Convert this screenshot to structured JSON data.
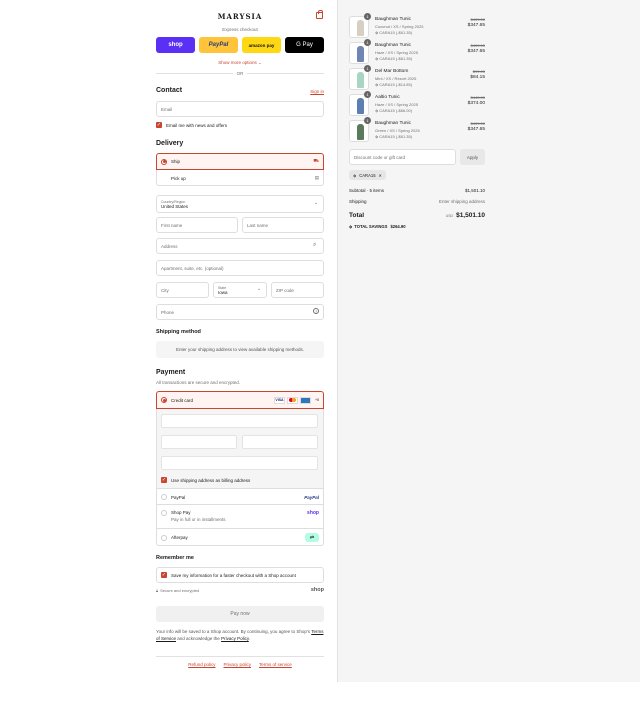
{
  "brand": {
    "logo": "MARYSIA"
  },
  "express": {
    "title": "Express checkout",
    "buttons": {
      "shop": "shop",
      "paypal": "PayPal",
      "amazon": "amazon pay",
      "gpay": "G Pay"
    },
    "show_more": "Show more options ⌄",
    "or": "OR"
  },
  "contact": {
    "heading": "Contact",
    "sign_in": "Sign in",
    "email_placeholder": "Email",
    "news_label": "Email me with news and offers"
  },
  "delivery": {
    "heading": "Delivery",
    "ship_label": "Ship",
    "pickup_label": "Pick up",
    "country_label": "Country/Region",
    "country_value": "United States",
    "first_name": "First name",
    "last_name": "Last name",
    "address": "Address",
    "apartment": "Apartment, suite, etc. (optional)",
    "city": "City",
    "state_label": "State",
    "state_value": "Iowa",
    "zip": "ZIP code",
    "phone": "Phone"
  },
  "shipping_method": {
    "heading": "Shipping method",
    "info": "Enter your shipping address to view available shipping methods."
  },
  "payment": {
    "heading": "Payment",
    "subtitle": "All transactions are secure and encrypted.",
    "credit_card": "Credit card",
    "card_more": "+5",
    "billing_label": "Use shipping address as billing address",
    "paypal": "PayPal",
    "shop_pay": "Shop Pay",
    "shop_pay_sub": "Pay in full or in installments",
    "afterpay": "Afterpay"
  },
  "remember": {
    "heading": "Remember me",
    "save_label": "Save my information for a faster checkout with a Shop account",
    "secure": "Secure and encrypted",
    "shop": "shop"
  },
  "pay_now": "Pay now",
  "legal": {
    "text1": "Your info will be saved to a Shop account. By continuing, you agree to Shop's",
    "terms": "Terms of Service",
    "text2": "and acknowledge the",
    "privacy": "Privacy Policy",
    "end": "."
  },
  "footer": {
    "refund": "Refund policy",
    "privacy": "Privacy policy",
    "terms": "Terms of service"
  },
  "cart": {
    "items": [
      {
        "qty": "1",
        "name": "Baughman Tunic",
        "variant": "Coconut / XS / Spring 2025",
        "discount": "CARA15 (-$61.35)",
        "old": "$409.00",
        "new": "$347.65",
        "color": "#d8cfc4"
      },
      {
        "qty": "1",
        "name": "Baughman Tunic",
        "variant": "Haze / XS / Spring 2025",
        "discount": "CARA15 (-$61.35)",
        "old": "$409.00",
        "new": "$347.65",
        "color": "#6f86b5"
      },
      {
        "qty": "1",
        "name": "Del Mar Bottom",
        "variant": "Mint / XS / Resort 2025",
        "discount": "CARA15 (-$14.85)",
        "old": "$99.00",
        "new": "$84.15",
        "color": "#a9d6c2"
      },
      {
        "qty": "1",
        "name": "Aaltio Tunic",
        "variant": "Haze / XS / Spring 2025",
        "discount": "CARA15 (-$66.00)",
        "old": "$440.00",
        "new": "$374.00",
        "color": "#5c7eb0"
      },
      {
        "qty": "1",
        "name": "Baughman Tunic",
        "variant": "Green / XS / Spring 2025",
        "discount": "CARA15 (-$61.35)",
        "old": "$409.00",
        "new": "$347.65",
        "color": "#5b7a5c"
      }
    ],
    "discount_placeholder": "Discount code or gift card",
    "apply": "Apply",
    "applied_code": "CARA15",
    "subtotal_label": "Subtotal · 5 items",
    "subtotal_value": "$1,501.10",
    "shipping_label": "Shipping",
    "shipping_value": "Enter shipping address",
    "total_label": "Total",
    "currency": "USD",
    "total_value": "$1,501.10",
    "savings_label": "TOTAL SAVINGS",
    "savings_value": "$264.90"
  },
  "colors": {
    "accent": "#c9452f",
    "shop": "#5a31f4",
    "paypal": "#ffc439",
    "amazon": "#ffd814"
  }
}
